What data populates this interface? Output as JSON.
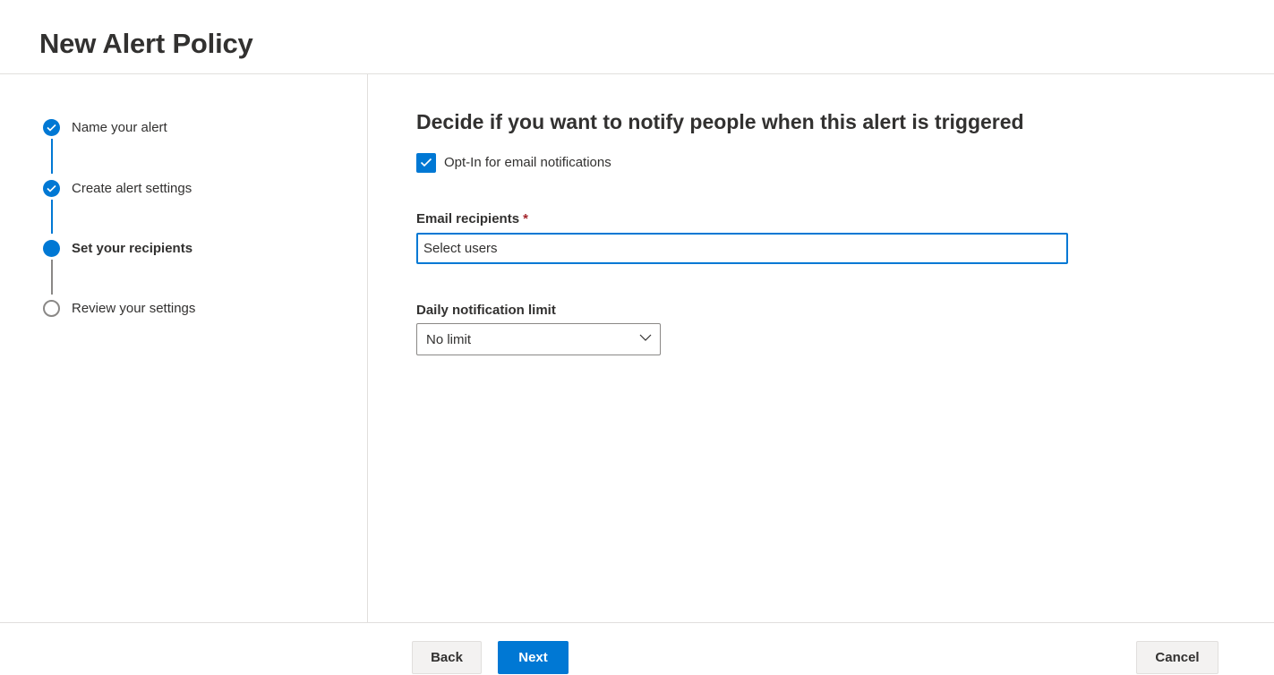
{
  "header": {
    "title": "New Alert Policy"
  },
  "steps": [
    {
      "label": "Name your alert",
      "state": "done"
    },
    {
      "label": "Create alert settings",
      "state": "done"
    },
    {
      "label": "Set your recipients",
      "state": "current"
    },
    {
      "label": "Review your settings",
      "state": "todo"
    }
  ],
  "main": {
    "heading": "Decide if you want to notify people when this alert is triggered",
    "optin": {
      "label": "Opt-In for email notifications",
      "checked": true
    },
    "recipients": {
      "label": "Email recipients",
      "required_mark": "*",
      "placeholder": "Select users",
      "value": ""
    },
    "limit": {
      "label": "Daily notification limit",
      "selected": "No limit"
    }
  },
  "footer": {
    "back_label": "Back",
    "next_label": "Next",
    "cancel_label": "Cancel"
  },
  "colors": {
    "accent": "#0078d4",
    "text": "#323130",
    "border": "#e1dfdd",
    "required": "#a4262c"
  },
  "icons": {
    "step_done": "checkmark-icon",
    "checkbox": "checkmark-icon",
    "select": "chevron-down-icon"
  }
}
